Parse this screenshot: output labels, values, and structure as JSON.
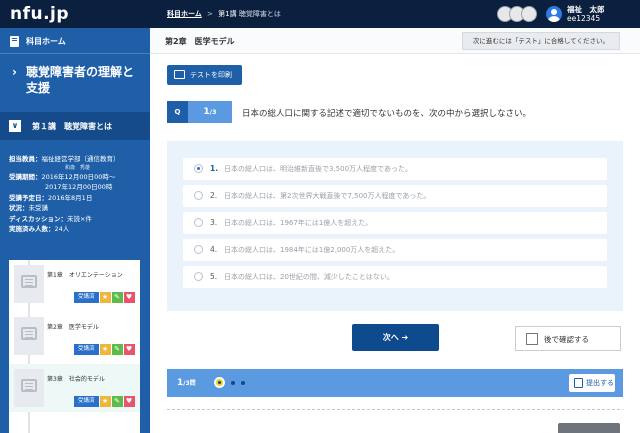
{
  "header": {
    "logo": "nfu.jp",
    "breadcrumb": {
      "home": "科目ホーム",
      "separator": ">",
      "lesson": "第1講",
      "topic": "聴覚障害とは"
    },
    "user": {
      "name": "福祉　太郎",
      "id": "ee12345"
    }
  },
  "sidebar": {
    "home_label": "科目ホーム",
    "course_title": "聴覚障害者の理解と支援",
    "lesson_label": "第１講　聴覚障害とは",
    "info": {
      "teacher_key": "担当教員：",
      "teacher_val": "福祉経営学部（通信教育）",
      "teacher_small": "和歳　秀雄",
      "period_key": "受講期間：",
      "period_val1": "2016年12月00日00時～",
      "period_val2": "2017年12月00日00時",
      "planned_key": "受講予定日：",
      "planned_val": "2016年8月1日",
      "status_key": "状況：",
      "status_val": "未受講",
      "discussion_key": "ディスカッション：",
      "discussion_val": "未読×件",
      "done_key": "実施済み人数：",
      "done_val": "24人"
    },
    "chapters": [
      {
        "label": "第1章　オリエンテーション",
        "badge": "受講済"
      },
      {
        "label": "第2章　医学モデル",
        "badge": "受講済"
      },
      {
        "label": "第3章　社会的モデル",
        "badge": "受講済"
      }
    ]
  },
  "main": {
    "chapter_title": "第2章　医学モデル",
    "notice": "次に進むには「テスト」に合格してください。",
    "print_label": "テストを印刷",
    "question": {
      "badge": "Q",
      "current": "1",
      "total": "/3",
      "text": "日本の総人口に関する記述で適切でないものを、次の中から選択しなさい。",
      "options": [
        {
          "num": "1.",
          "text": "日本の総人口は、明治維新直後で3,500万人程度であった。",
          "selected": true
        },
        {
          "num": "2.",
          "text": "日本の総人口は、第2次世界大戦直後で7,500万人程度であった。",
          "selected": false
        },
        {
          "num": "3.",
          "text": "日本の総人口は、1967年には1億人を超えた。",
          "selected": false
        },
        {
          "num": "4.",
          "text": "日本の総人口は、1984年には1億2,000万人を超えた。",
          "selected": false
        },
        {
          "num": "5.",
          "text": "日本の総人口は、20世紀の間、減少したことはない。",
          "selected": false
        }
      ]
    },
    "next_label": "次へ ➔",
    "later_label": "後で確認する",
    "progress": {
      "current": "1",
      "total": "/3問",
      "submit_label": "提出する"
    }
  },
  "colors": {
    "topbar": "#0b1f3f",
    "sidebar": "#1f5fa8",
    "accent": "#5b9ae0",
    "next_button": "#0e4a8e",
    "current_dot": "#f0d11c"
  }
}
